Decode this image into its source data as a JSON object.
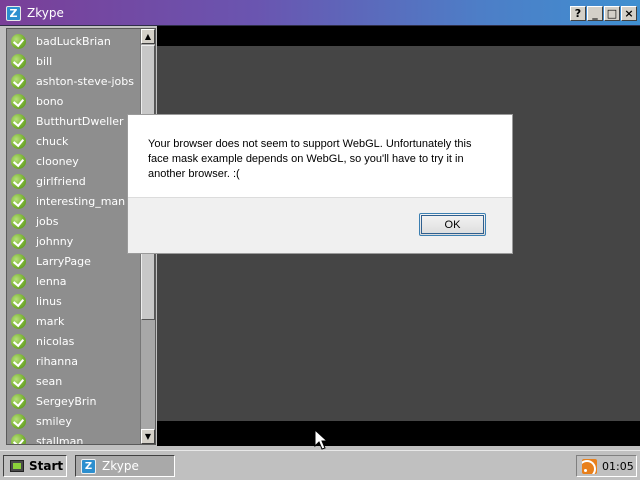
{
  "window": {
    "title": "Zkype",
    "logo_letter": "Z",
    "controls": {
      "help": "?",
      "minimize": "_",
      "maximize": "□",
      "close": "×"
    }
  },
  "contacts": [
    {
      "name": "badLuckBrian"
    },
    {
      "name": "bill"
    },
    {
      "name": "ashton-steve-jobs"
    },
    {
      "name": "bono"
    },
    {
      "name": "ButthurtDweller"
    },
    {
      "name": "chuck"
    },
    {
      "name": "clooney"
    },
    {
      "name": "girlfriend"
    },
    {
      "name": "interesting_man"
    },
    {
      "name": "jobs"
    },
    {
      "name": "johnny"
    },
    {
      "name": "LarryPage"
    },
    {
      "name": "lenna"
    },
    {
      "name": "linus"
    },
    {
      "name": "mark"
    },
    {
      "name": "nicolas"
    },
    {
      "name": "rihanna"
    },
    {
      "name": "sean"
    },
    {
      "name": "SergeyBrin"
    },
    {
      "name": "smiley"
    },
    {
      "name": "stallman"
    }
  ],
  "scroll": {
    "up_arrow": "▲",
    "down_arrow": "▼"
  },
  "dialog": {
    "message": "Your browser does not seem to support WebGL. Unfortunately this face mask example depends on WebGL, so you'll have to try it in another browser. :(",
    "ok_label": "OK"
  },
  "taskbar": {
    "start_label": "Start",
    "task_label": "Zkype",
    "task_icon_letter": "Z",
    "clock": "01:05"
  },
  "colors": {
    "title_gradient_start": "#7a3f98",
    "title_gradient_end": "#3f8fd0",
    "status_online": "#7ab234",
    "canvas_bg": "#454545",
    "rss": "#e8801c"
  }
}
